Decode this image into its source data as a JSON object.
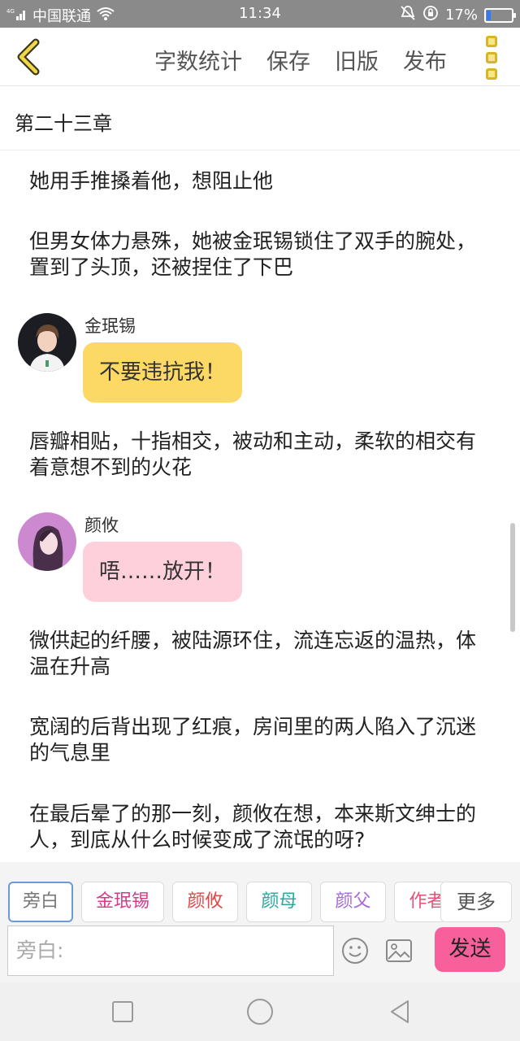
{
  "status_bar": {
    "carrier": "中国联通",
    "time": "11:34",
    "battery": "17%",
    "battery_level": 0.17
  },
  "toolbar": {
    "word_count": "字数统计",
    "save": "保存",
    "old_version": "旧版",
    "publish": "发布"
  },
  "chapter": {
    "title": "第二十三章"
  },
  "content": {
    "p1": "她用手推搡着他，想阻止他",
    "p2": "但男女体力悬殊，她被金珉锡锁住了双手的腕处，置到了头顶，还被捏住了下巴",
    "msg1": {
      "name": "金珉锡",
      "text": "不要违抗我！"
    },
    "p3": "唇瓣相贴，十指相交，被动和主动，柔软的相交有着意想不到的火花",
    "msg2": {
      "name": "颜攸",
      "text": "唔……放开！"
    },
    "p4": "微供起的纤腰，被陆源环住，流连忘返的温热，体温在升高",
    "p5": "宽阔的后背出现了红痕，房间里的两人陷入了沉迷的气息里",
    "p6": "在最后晕了的那一刻，颜攸在想，本来斯文绅士的人，到底从什么时候变成了流氓的呀?"
  },
  "input": {
    "roles": [
      {
        "label": "旁白",
        "color": "#777777"
      },
      {
        "label": "金珉锡",
        "color": "#d6398a"
      },
      {
        "label": "颜攸",
        "color": "#e04848"
      },
      {
        "label": "颜母",
        "color": "#29a8a0"
      },
      {
        "label": "颜父",
        "color": "#a86ad8"
      },
      {
        "label": "作者",
        "color": "#e8507a"
      }
    ],
    "more": "更多",
    "placeholder": "旁白:",
    "send": "发送"
  }
}
